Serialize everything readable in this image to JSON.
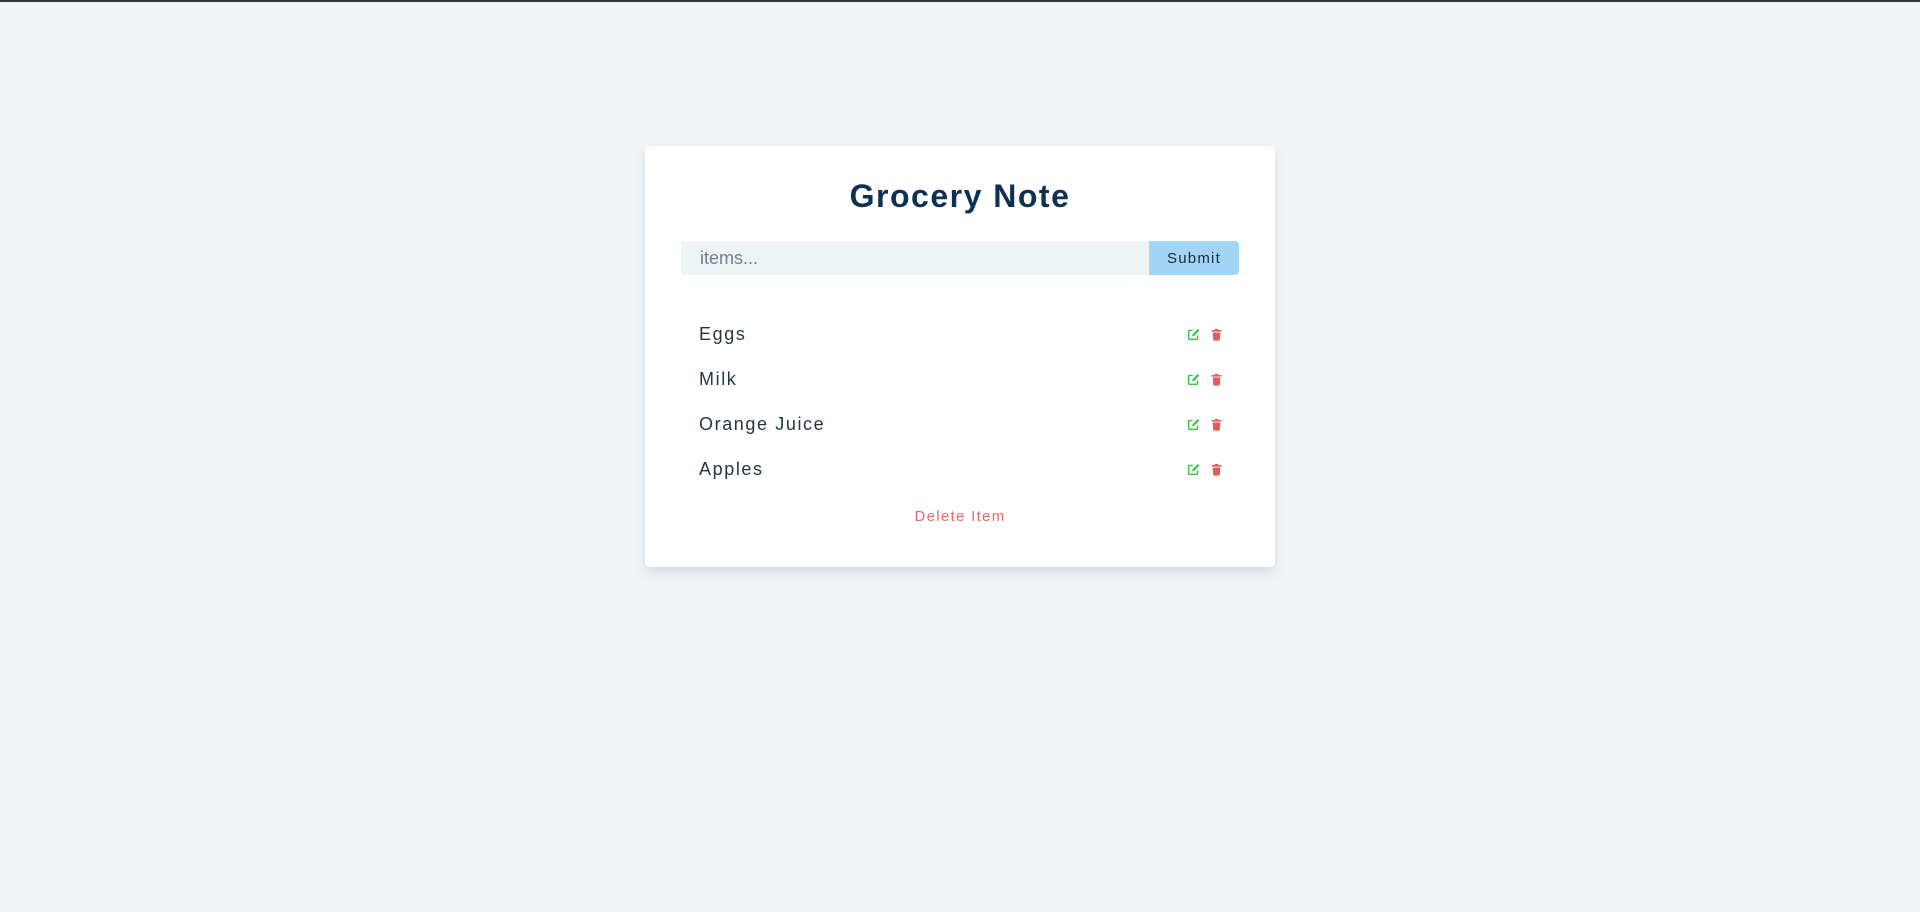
{
  "app": {
    "title": "Grocery Note"
  },
  "form": {
    "input_value": "",
    "input_placeholder": "items...",
    "submit_label": "Submit"
  },
  "items": [
    {
      "name": "Eggs"
    },
    {
      "name": "Milk"
    },
    {
      "name": "Orange Juice"
    },
    {
      "name": "Apples"
    }
  ],
  "icons": {
    "edit": "edit-icon",
    "delete": "trash-icon"
  },
  "colors": {
    "background": "#f0f4f7",
    "title": "#0d3152",
    "submit": "#a3d5f7",
    "edit_icon": "#3cc44b",
    "delete_icon": "#e25c5c",
    "clear_text": "#e46b6b"
  },
  "footer": {
    "clear_label": "Delete Item"
  }
}
